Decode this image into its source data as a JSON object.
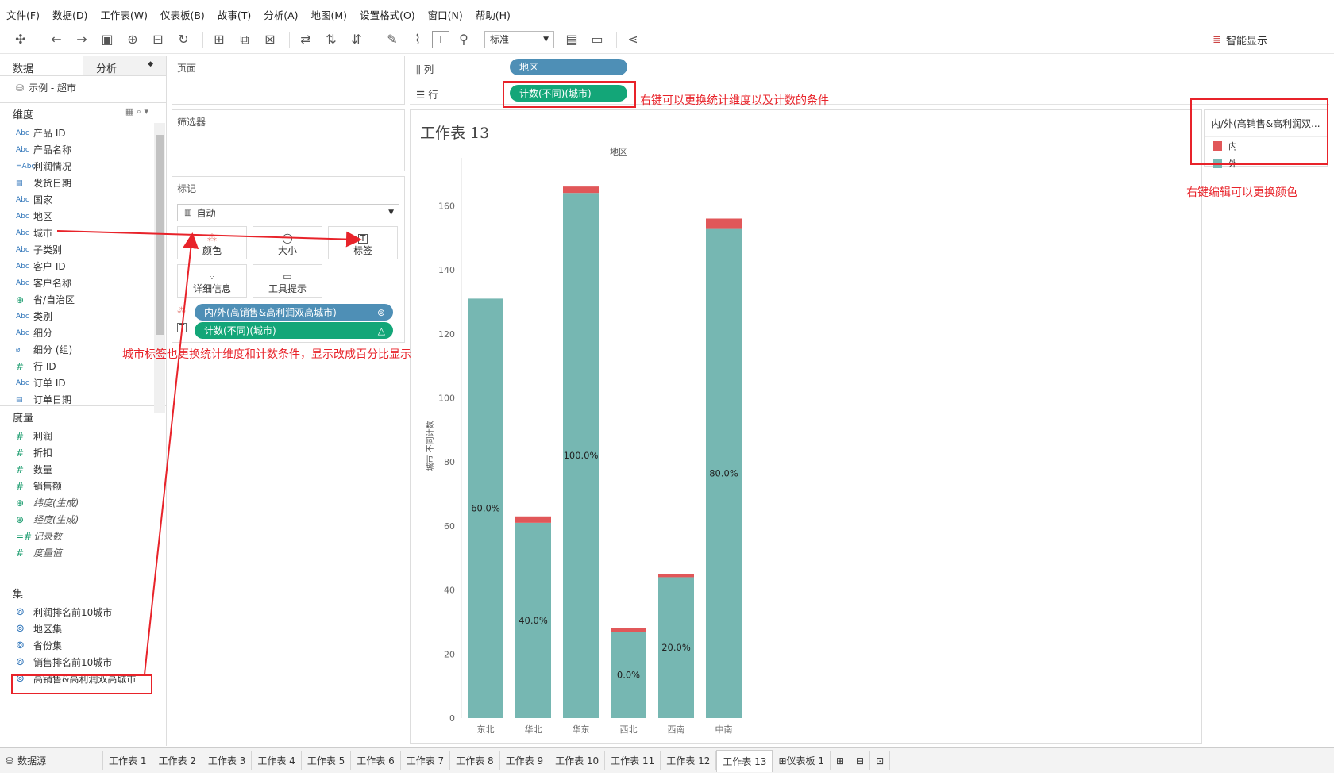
{
  "menu": [
    "文件(F)",
    "数据(D)",
    "工作表(W)",
    "仪表板(B)",
    "故事(T)",
    "分析(A)",
    "地图(M)",
    "设置格式(O)",
    "窗口(N)",
    "帮助(H)"
  ],
  "toolbar": {
    "fit_select": "标准",
    "show_me": "智能显示"
  },
  "datapane": {
    "tab_data": "数据",
    "tab_analysis": "分析",
    "datasource": "示例 - 超市",
    "dimensions_title": "维度",
    "dimensions": [
      {
        "icon": "Abc",
        "label": "产品 ID"
      },
      {
        "icon": "Abc",
        "label": "产品名称"
      },
      {
        "icon": "=Abc",
        "label": "利润情况"
      },
      {
        "icon": "calendar",
        "label": "发货日期"
      },
      {
        "icon": "Abc",
        "label": "国家"
      },
      {
        "icon": "Abc",
        "label": "地区"
      },
      {
        "icon": "Abc",
        "label": "城市"
      },
      {
        "icon": "Abc",
        "label": "子类别"
      },
      {
        "icon": "Abc",
        "label": "客户 ID"
      },
      {
        "icon": "Abc",
        "label": "客户名称"
      },
      {
        "icon": "globe",
        "label": "省/自治区"
      },
      {
        "icon": "Abc",
        "label": "类别"
      },
      {
        "icon": "Abc",
        "label": "细分"
      },
      {
        "icon": "paperclip",
        "label": "细分 (组)"
      },
      {
        "icon": "#",
        "label": "行 ID"
      },
      {
        "icon": "Abc",
        "label": "订单 ID"
      },
      {
        "icon": "calendar",
        "label": "订单日期"
      }
    ],
    "measures_title": "度量",
    "measures": [
      {
        "icon": "#",
        "label": "利润",
        "italic": false
      },
      {
        "icon": "#",
        "label": "折扣",
        "italic": false
      },
      {
        "icon": "#",
        "label": "数量",
        "italic": false
      },
      {
        "icon": "#",
        "label": "销售额",
        "italic": false
      },
      {
        "icon": "globe",
        "label": "纬度(生成)",
        "italic": true
      },
      {
        "icon": "globe",
        "label": "经度(生成)",
        "italic": true
      },
      {
        "icon": "=#",
        "label": "记录数",
        "italic": true
      },
      {
        "icon": "#",
        "label": "度量值",
        "italic": true
      }
    ],
    "sets_title": "集",
    "sets": [
      "利润排名前10城市",
      "地区集",
      "省份集",
      "销售排名前10城市",
      "高销售&高利润双高城市"
    ]
  },
  "cards": {
    "pages_title": "页面",
    "filters_title": "筛选器",
    "marks_title": "标记",
    "mark_type": "自动",
    "btn_color": "颜色",
    "btn_size": "大小",
    "btn_label": "标签",
    "btn_detail": "详细信息",
    "btn_tooltip": "工具提示",
    "pill_color": "内/外(高销售&高利润双高城市)",
    "pill_label": "计数(不同)(城市)"
  },
  "shelves": {
    "columns_label": "列",
    "rows_label": "行",
    "columns_pill": "地区",
    "rows_pill": "计数(不同)(城市)"
  },
  "annotations": {
    "rows_note": "右键可以更换统计维度以及计数的条件",
    "legend_note": "右键编辑可以更换颜色",
    "label_note": "城市标签也更换统计维度和计数条件，显示改成百分比显示"
  },
  "sheet": {
    "title": "工作表 13"
  },
  "legend": {
    "title": "内/外(高销售&高利润双...",
    "items": [
      {
        "label": "内",
        "color": "#e15759"
      },
      {
        "label": "外",
        "color": "#76b7b2"
      }
    ]
  },
  "chart_data": {
    "type": "bar",
    "title": "",
    "header": "地区",
    "xlabel": "",
    "ylabel": "城市 不同计数",
    "ylim": [
      0,
      170
    ],
    "yticks": [
      0,
      20,
      40,
      60,
      80,
      100,
      120,
      140,
      160
    ],
    "categories": [
      "东北",
      "华北",
      "华东",
      "西北",
      "西南",
      "中南"
    ],
    "series": [
      {
        "name": "外",
        "color": "#76b7b2",
        "values": [
          131,
          61,
          164,
          27,
          44,
          153
        ]
      },
      {
        "name": "内",
        "color": "#e15759",
        "values": [
          0,
          2,
          2,
          1,
          1,
          3
        ]
      }
    ],
    "data_labels": [
      "60.0%",
      "40.0%",
      "100.0%",
      "0.0%",
      "20.0%",
      "80.0%"
    ]
  },
  "bottom_tabs": {
    "datasource": "数据源",
    "sheets": [
      "工作表 1",
      "工作表 2",
      "工作表 3",
      "工作表 4",
      "工作表 5",
      "工作表 6",
      "工作表 7",
      "工作表 8",
      "工作表 9",
      "工作表 10",
      "工作表 11",
      "工作表 12",
      "工作表 13",
      "仪表板 1"
    ],
    "active": "工作表 13"
  }
}
